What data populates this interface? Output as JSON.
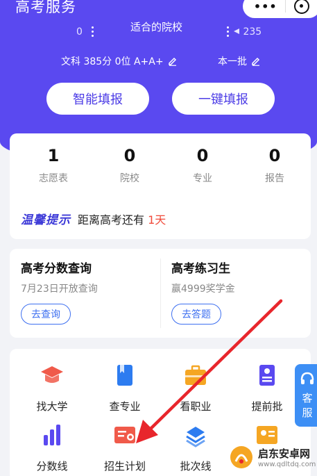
{
  "header": {
    "title": "高考服务"
  },
  "capsule": {
    "more_label": "•••"
  },
  "summary": {
    "left_count": "0",
    "mid_text": "适合的院校",
    "right_count": "235"
  },
  "profile": {
    "subject_score": "文科 385分 0位 A+A+",
    "batch": "本一批"
  },
  "hero_buttons": {
    "smart_fill": "智能填报",
    "one_click_fill": "一键填报"
  },
  "stats": [
    {
      "value": "1",
      "label": "志愿表"
    },
    {
      "value": "0",
      "label": "院校"
    },
    {
      "value": "0",
      "label": "专业"
    },
    {
      "value": "0",
      "label": "报告"
    }
  ],
  "tip": {
    "badge": "温馨提示",
    "text": "距离高考还有",
    "days": "1天"
  },
  "query": {
    "left": {
      "title": "高考分数查询",
      "sub": "7月23日开放查询",
      "button": "去查询"
    },
    "right": {
      "title": "高考练习生",
      "sub": "赢4999奖学金",
      "button": "去答题"
    }
  },
  "grid": {
    "row1": [
      {
        "label": "找大学",
        "icon": "graduation-cap-icon",
        "color": "#f05a4a"
      },
      {
        "label": "查专业",
        "icon": "book-icon",
        "color": "#2d7cf0"
      },
      {
        "label": "看职业",
        "icon": "briefcase-icon",
        "color": "#f5a623"
      },
      {
        "label": "提前批",
        "icon": "scroll-icon",
        "color": "#5a49f0"
      }
    ],
    "row2": [
      {
        "label": "分数线",
        "icon": "bar-chart-icon",
        "color": "#5a49f0"
      },
      {
        "label": "招生计划",
        "icon": "plan-card-icon",
        "color": "#f05a4a"
      },
      {
        "label": "批次线",
        "icon": "layers-icon",
        "color": "#2d7cf0"
      },
      {
        "label": "",
        "icon": "profile-card-icon",
        "color": "#f5a623"
      }
    ]
  },
  "service": {
    "line1": "客",
    "line2": "服"
  },
  "watermark": {
    "name": "启东安卓网",
    "url": "www.qdltdq.com"
  },
  "colors": {
    "primary": "#5a49f0",
    "accent_red": "#f04a3a",
    "link_blue": "#3d6ff0"
  }
}
